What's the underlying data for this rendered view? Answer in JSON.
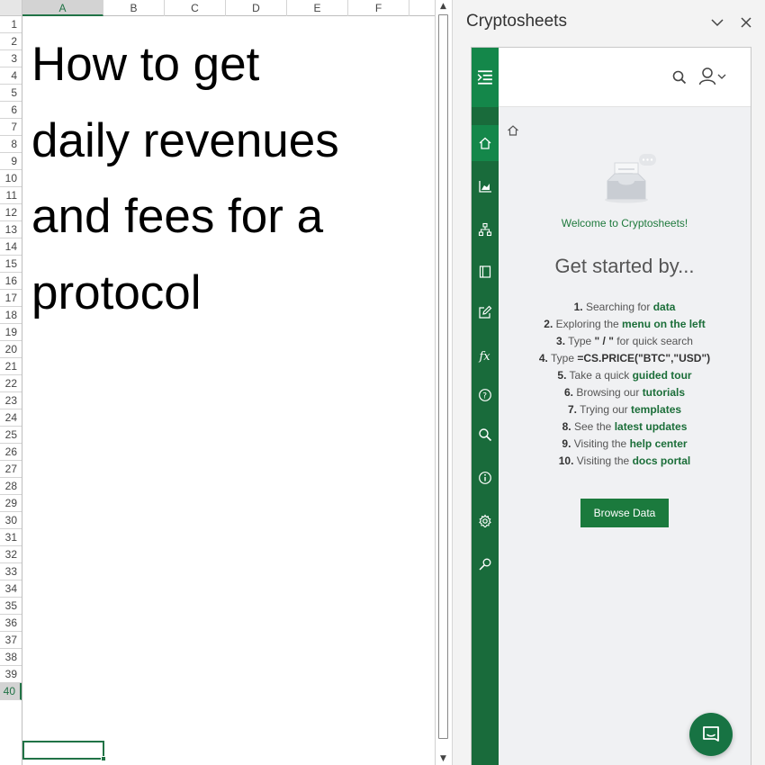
{
  "sheet": {
    "columns": [
      "A",
      "B",
      "C",
      "D",
      "E",
      "F"
    ],
    "active_column": "A",
    "rows": [
      "1",
      "2",
      "3",
      "4",
      "5",
      "6",
      "7",
      "8",
      "9",
      "10",
      "11",
      "12",
      "13",
      "14",
      "15",
      "16",
      "17",
      "18",
      "19",
      "20",
      "21",
      "22",
      "23",
      "24",
      "25",
      "26",
      "27",
      "28",
      "29",
      "30",
      "31",
      "32",
      "33",
      "34",
      "35",
      "36",
      "37",
      "38",
      "39",
      "40"
    ],
    "active_row": "40",
    "title_lines": [
      "How to get",
      "daily revenues",
      "and fees for a",
      "protocol"
    ]
  },
  "pane": {
    "title": "Cryptosheets",
    "collapse_icon": "chevron-down-icon",
    "close_icon": "close-icon"
  },
  "addin": {
    "welcome": "Welcome to Cryptosheets!",
    "heading": "Get started by...",
    "steps": [
      {
        "num": "1.",
        "pre": "Searching for",
        "bold": "data",
        "post": ""
      },
      {
        "num": "2.",
        "pre": "Exploring the",
        "bold": "menu on the left",
        "post": ""
      },
      {
        "num": "3.",
        "pre": "Type",
        "bold": "\" / \"",
        "post": "for quick search"
      },
      {
        "num": "4.",
        "pre": "Type",
        "bold": "=CS.PRICE(\"BTC\",\"USD\")",
        "post": ""
      },
      {
        "num": "5.",
        "pre": "Take a quick",
        "bold": "guided tour",
        "post": ""
      },
      {
        "num": "6.",
        "pre": "Browsing our",
        "bold": "tutorials",
        "post": ""
      },
      {
        "num": "7.",
        "pre": "Trying our",
        "bold": "templates",
        "post": ""
      },
      {
        "num": "8.",
        "pre": "See the",
        "bold": "latest updates",
        "post": ""
      },
      {
        "num": "9.",
        "pre": "Visiting the",
        "bold": "help center",
        "post": ""
      },
      {
        "num": "10.",
        "pre": "Visiting the",
        "bold": "docs portal",
        "post": ""
      }
    ],
    "browse_button": "Browse Data",
    "rail_icons": [
      "home-icon",
      "chart-icon",
      "sitemap-icon",
      "book-icon",
      "edit-icon",
      "function-icon",
      "help-icon",
      "search-icon",
      "info-icon",
      "gear-icon",
      "key-icon"
    ],
    "active_rail_item": "home-icon"
  },
  "colors": {
    "excel_green": "#217346",
    "rail_green": "#196b3b",
    "rail_active": "#14874a",
    "button_green": "#1b7a3d",
    "chat_green": "#177343"
  }
}
